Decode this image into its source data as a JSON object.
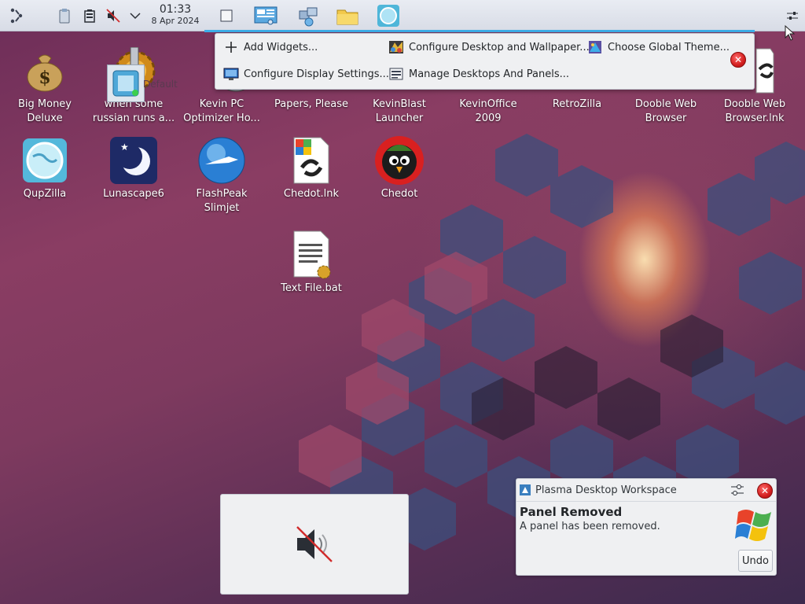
{
  "panel": {
    "clock_time": "01:33",
    "clock_date": "8 Apr 2024",
    "icons": [
      "application-launcher-icon",
      "clipboard-icon",
      "battery-icon",
      "volume-muted-icon",
      "chevron-down-icon"
    ],
    "tasks": [
      "window-icon",
      "control-panel-icon",
      "network-icon",
      "folder-icon",
      "qupzilla-icon"
    ],
    "settings_icon": "panel-settings-icon",
    "accent": "#3daee9"
  },
  "context_menu": {
    "add_widgets": "Add Widgets...",
    "configure_desktop": "Configure Desktop and Wallpaper...",
    "choose_theme": "Choose Global Theme...",
    "configure_display": "Configure Display Settings...",
    "manage_desktops": "Manage Desktops And Panels..."
  },
  "desktop_icons": [
    {
      "label": "Big Money Deluxe",
      "icon": "money-bag-icon"
    },
    {
      "label": "when some russian runs a...",
      "icon": "gear-icon"
    },
    {
      "label": "Kevin PC Optimizer Ho...",
      "icon": "optimizer-icon"
    },
    {
      "label": "Papers, Please",
      "icon": "papers-icon"
    },
    {
      "label": "KevinBlast Launcher",
      "icon": "launcher-icon"
    },
    {
      "label": "KevinOffice 2009",
      "icon": "office-icon"
    },
    {
      "label": "RetroZilla",
      "icon": "retrozilla-icon"
    },
    {
      "label": "Dooble Web Browser",
      "icon": "dooble-icon"
    },
    {
      "label": "Dooble Web Browser.lnk",
      "icon": "shortcut-icon"
    },
    {
      "label": "QupZilla",
      "icon": "globe-icon"
    },
    {
      "label": "Lunascape6",
      "icon": "moon-icon"
    },
    {
      "label": "FlashPeak Slimjet",
      "icon": "jet-globe-icon"
    },
    {
      "label": "Chedot.lnk",
      "icon": "shortcut-icon"
    },
    {
      "label": "Chedot",
      "icon": "chedot-bird-icon"
    },
    {
      "label": "Text File.bat",
      "icon": "batch-file-icon"
    }
  ],
  "drag_ghost_label": "Default",
  "notification": {
    "app": "Plasma Desktop Workspace",
    "title": "Panel Removed",
    "body": "A panel has been removed.",
    "undo": "Undo"
  },
  "osd": {
    "icon": "volume-muted-icon"
  }
}
